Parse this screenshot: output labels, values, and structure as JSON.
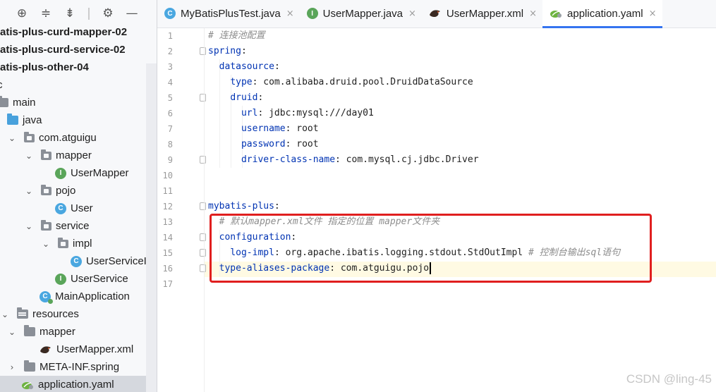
{
  "project_panel": {
    "toolbar": {
      "locate_icon": "crosshair-icon",
      "expand_icon": "expand-all-icon",
      "collapse_icon": "collapse-all-icon",
      "settings_icon": "gear-icon",
      "hide_icon": "minus-icon"
    },
    "tree": [
      {
        "label": "atis-plus-curd-mapper-02",
        "bold": true,
        "icon": "none",
        "chevron": ""
      },
      {
        "label": "atis-plus-curd-service-02",
        "bold": true,
        "icon": "none",
        "chevron": ""
      },
      {
        "label": "atis-plus-other-04",
        "bold": true,
        "icon": "none",
        "chevron": ""
      },
      {
        "label": "c",
        "bold": false,
        "icon": "none",
        "chevron": ""
      },
      {
        "label": "main",
        "bold": false,
        "icon": "folder-icon",
        "chevron": ""
      },
      {
        "label": "java",
        "bold": false,
        "icon": "source-folder-icon",
        "chevron": ""
      },
      {
        "label": "com.atguigu",
        "bold": false,
        "icon": "package-icon",
        "chevron": "v"
      },
      {
        "label": "mapper",
        "bold": false,
        "icon": "package-icon",
        "chevron": "v"
      },
      {
        "label": "UserMapper",
        "bold": false,
        "icon": "interface-icon",
        "chevron": ""
      },
      {
        "label": "pojo",
        "bold": false,
        "icon": "package-icon",
        "chevron": "v"
      },
      {
        "label": "User",
        "bold": false,
        "icon": "class-icon",
        "chevron": ""
      },
      {
        "label": "service",
        "bold": false,
        "icon": "package-icon",
        "chevron": "v"
      },
      {
        "label": "impl",
        "bold": false,
        "icon": "package-icon",
        "chevron": "v"
      },
      {
        "label": "UserServiceIm",
        "bold": false,
        "icon": "class-icon",
        "chevron": ""
      },
      {
        "label": "UserService",
        "bold": false,
        "icon": "interface-icon",
        "chevron": ""
      },
      {
        "label": "MainApplication",
        "bold": false,
        "icon": "spring-main-class-icon",
        "chevron": ""
      },
      {
        "label": "resources",
        "bold": false,
        "icon": "resources-folder-icon",
        "chevron": "v"
      },
      {
        "label": "mapper",
        "bold": false,
        "icon": "folder-icon",
        "chevron": "v"
      },
      {
        "label": "UserMapper.xml",
        "bold": false,
        "icon": "mybatis-xml-icon",
        "chevron": ""
      },
      {
        "label": "META-INF.spring",
        "bold": false,
        "icon": "folder-icon",
        "chevron": ">"
      },
      {
        "label": "application.yaml",
        "bold": false,
        "icon": "spring-yaml-icon",
        "chevron": ""
      }
    ]
  },
  "tabs": [
    {
      "label": "MyBatisPlusTest.java",
      "icon": "class-icon",
      "active": false
    },
    {
      "label": "UserMapper.java",
      "icon": "interface-icon",
      "active": false
    },
    {
      "label": "UserMapper.xml",
      "icon": "mybatis-xml-icon",
      "active": false
    },
    {
      "label": "application.yaml",
      "icon": "spring-yaml-icon",
      "active": true
    }
  ],
  "tab_close_glyph": "×",
  "editor": {
    "line_numbers": [
      "1",
      "2",
      "3",
      "4",
      "5",
      "6",
      "7",
      "8",
      "9",
      "10",
      "11",
      "12",
      "13",
      "14",
      "15",
      "16",
      "17"
    ],
    "lines": [
      {
        "indent": "",
        "key": "",
        "value": "",
        "comment": "# 连接池配置"
      },
      {
        "indent": "",
        "key": "spring",
        "value": ":",
        "comment": ""
      },
      {
        "indent": "  ",
        "key": "datasource",
        "value": ":",
        "comment": ""
      },
      {
        "indent": "    ",
        "key": "type",
        "value": ": com.alibaba.druid.pool.DruidDataSource",
        "comment": ""
      },
      {
        "indent": "    ",
        "key": "druid",
        "value": ":",
        "comment": ""
      },
      {
        "indent": "      ",
        "key": "url",
        "value": ": jdbc:mysql:///day01",
        "comment": ""
      },
      {
        "indent": "      ",
        "key": "username",
        "value": ": root",
        "comment": ""
      },
      {
        "indent": "      ",
        "key": "password",
        "value": ": root",
        "comment": ""
      },
      {
        "indent": "      ",
        "key": "driver-class-name",
        "value": ": com.mysql.cj.jdbc.Driver",
        "comment": ""
      },
      {
        "indent": "",
        "key": "",
        "value": "",
        "comment": ""
      },
      {
        "indent": "",
        "key": "",
        "value": "",
        "comment": ""
      },
      {
        "indent": "",
        "key": "mybatis-plus",
        "value": ":",
        "comment": ""
      },
      {
        "indent": "  ",
        "key": "",
        "value": "",
        "comment": "# 默认mapper.xml文件 指定的位置 mapper文件夹"
      },
      {
        "indent": "  ",
        "key": "configuration",
        "value": ":",
        "comment": ""
      },
      {
        "indent": "    ",
        "key": "log-impl",
        "value": ": org.apache.ibatis.logging.stdout.StdOutImpl ",
        "comment": "# 控制台输出sql语句"
      },
      {
        "indent": "  ",
        "key": "type-aliases-package",
        "value": ": com.atguigu.pojo",
        "comment": ""
      },
      {
        "indent": "",
        "key": "",
        "value": "",
        "comment": ""
      }
    ],
    "current_line": "16"
  },
  "watermark": "CSDN @ling-45",
  "colors": {
    "key": "#0033b3",
    "comment": "#8c8c8c",
    "highlight_box": "#e01f1f",
    "tab_active_underline": "#3574f0"
  }
}
